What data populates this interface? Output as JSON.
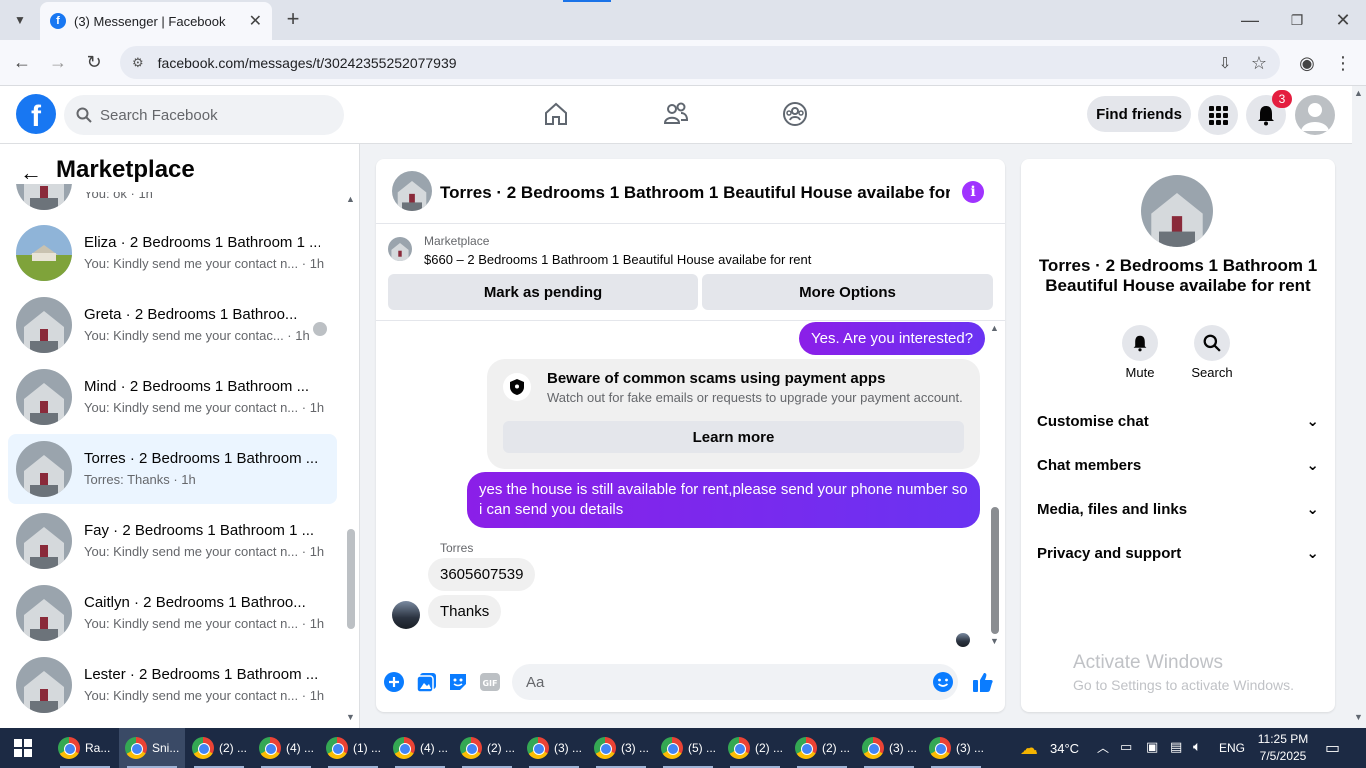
{
  "browser": {
    "tab_title": "(3) Messenger | Facebook",
    "url": "facebook.com/messages/t/30242355252077939"
  },
  "fb": {
    "search_placeholder": "Search Facebook",
    "find_friends": "Find friends",
    "notification_count": "3"
  },
  "left": {
    "title": "Marketplace",
    "partial_sub": "You: ok · 1h",
    "conversations": [
      {
        "name": "Eliza · 2 Bedrooms 1 Bathroom 1 ...",
        "sub": "You: Kindly send me your contact n... · 1h",
        "active": false
      },
      {
        "name": "Greta · 2 Bedrooms 1 Bathroo...",
        "sub": "You: Kindly send me your contac... · 1h",
        "active": false
      },
      {
        "name": "Mind · 2 Bedrooms 1 Bathroom ...",
        "sub": "You: Kindly send me your contact n... · 1h",
        "active": false
      },
      {
        "name": "Torres · 2 Bedrooms 1 Bathroom ...",
        "sub": "Torres: Thanks · 1h",
        "active": true
      },
      {
        "name": "Fay · 2 Bedrooms 1 Bathroom 1 ...",
        "sub": "You: Kindly send me your contact n... · 1h",
        "active": false
      },
      {
        "name": "Caitlyn · 2 Bedrooms 1 Bathroo...",
        "sub": "You: Kindly send me your contact n... · 1h",
        "active": false
      },
      {
        "name": "Lester · 2 Bedrooms 1 Bathroom ...",
        "sub": "You: Kindly send me your contact n... · 1h",
        "active": false
      }
    ]
  },
  "chat": {
    "title": "Torres · 2 Bedrooms 1 Bathroom 1 Beautiful House availabe for r...",
    "marketplace_label": "Marketplace",
    "listing": "$660 – 2 Bedrooms 1 Bathroom 1 Beautiful House availabe for rent",
    "mark_pending": "Mark as pending",
    "more_options": "More Options",
    "msg1": "Yes. Are you interested?",
    "scam_title": "Beware of common scams using payment apps",
    "scam_body": "Watch out for fake emails or requests to upgrade your payment account.",
    "learn_more": "Learn more",
    "msg2": "yes the house is still available for rent,please send your  phone number so i can send you details",
    "sender": "Torres",
    "msg3": "3605607539",
    "msg4": "Thanks",
    "composer_placeholder": "Aa"
  },
  "right": {
    "name": "Torres · 2 Bedrooms 1 Bathroom 1 Beautiful House availabe for rent",
    "mute": "Mute",
    "search": "Search",
    "rows": [
      "Customise chat",
      "Chat members",
      "Media, files and links",
      "Privacy and support"
    ],
    "watermark_title": "Activate Windows",
    "watermark_sub": "Go to Settings to activate Windows."
  },
  "taskbar": {
    "apps": [
      "Ra...",
      "Sni...",
      "(2) ...",
      "(4) ...",
      "(1) ...",
      "(4) ...",
      "(2) ...",
      "(3) ...",
      "(3) ...",
      "(5) ...",
      "(2) ...",
      "(2) ...",
      "(3) ...",
      "(3) ..."
    ],
    "temperature": "34°C",
    "language": "ENG",
    "time": "11:25 PM",
    "date": "7/5/2025"
  },
  "colors": {
    "fb_blue": "#1877f2",
    "message_purple": "#7b2ff7",
    "badge_red": "#e41e3f"
  }
}
